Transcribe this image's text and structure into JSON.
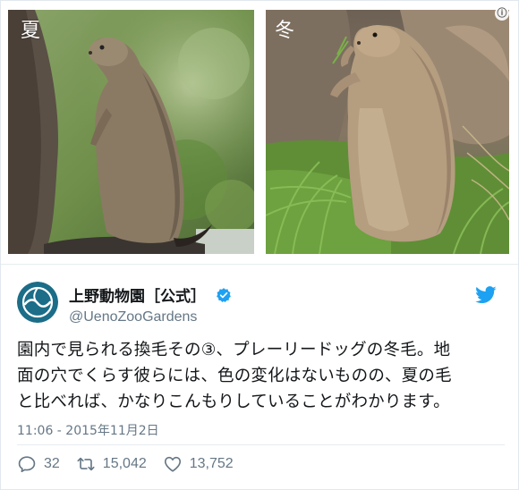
{
  "photos": {
    "left_label": "夏",
    "right_label": "冬",
    "info_icon": "ⓘ"
  },
  "account": {
    "display_name": "上野動物園［公式］",
    "handle": "@UenoZooGardens",
    "avatar_icon": "ueno-zoo-logo-icon",
    "verified_icon": "verified-badge-icon",
    "bird_icon": "twitter-bird-icon",
    "accent_color": "#1da1f2",
    "avatar_color": "#1b6d88"
  },
  "tweet": {
    "text_lines": [
      "園内で見られる換毛その③、プレーリードッグの冬毛。地",
      "面の穴でくらす彼らには、色の変化はないものの、夏の毛",
      "と比べれば、かなりこんもりしていることがわかります。"
    ],
    "timestamp": "11:06 - 2015年11月2日"
  },
  "actions": {
    "reply_count": "32",
    "retweet_count": "15,042",
    "like_count": "13,752"
  }
}
